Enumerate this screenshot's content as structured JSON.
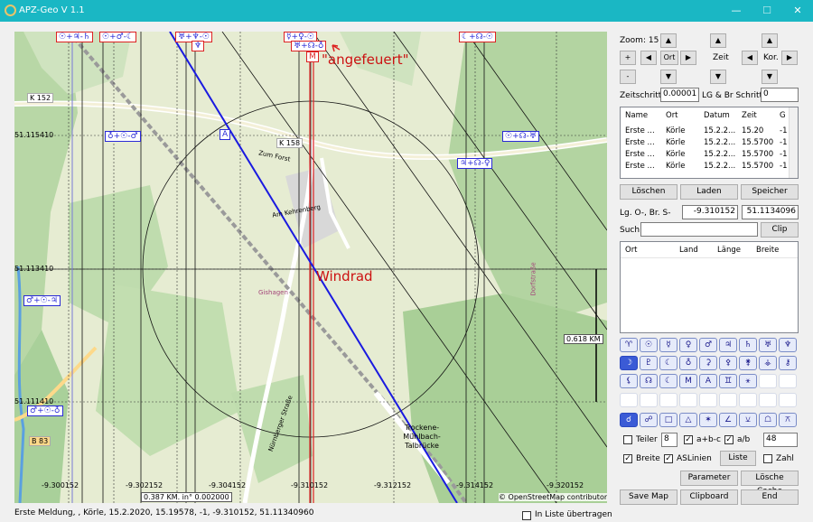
{
  "window": {
    "title": "APZ-Geo V 1.1",
    "minimize": "—",
    "maximize": "☐",
    "close": "✕"
  },
  "map": {
    "annotation_top": "\"angefeuert\"",
    "annotation_center": "Windrad",
    "attribution": "© OpenStreetMap contributors",
    "scale_text": "0.387 KM. in° 0.002000",
    "distance_label": "0.618 KM",
    "left_lat_labels": [
      "51.115410",
      "51.113410",
      "51.111410"
    ],
    "bottom_lon_labels": [
      "-9.300152",
      "-9.302152",
      "-9.304152",
      "-9.310152",
      "-9.312152",
      "-9.314152",
      "-9.320152"
    ],
    "place_labels": [
      "K 152",
      "K 158",
      "Zum Forst",
      "Am Kehrenberg",
      "Gishagen",
      "Nürnberger Straße",
      "Trockene-Mühlbach-Talbrücke",
      "B 83",
      "Dorfstraße"
    ],
    "top_boxes": [
      "☉+♃-♄",
      "☉+♂-☾",
      "♅+♆-☉",
      "♆",
      "☿+♀-☉",
      "♅+☊-♁",
      "M",
      "☾+☊-☉"
    ],
    "left_boxes": [
      "♁+☉-♂",
      "♂+☉-♃",
      "♂+☉-♁"
    ],
    "right_boxes": [
      "☉+☊-♅",
      "♃+☊-♀"
    ],
    "marker_A": "A"
  },
  "panel": {
    "zoom_label": "Zoom: 15",
    "zeit_label": "Zeit",
    "kor_label": "Kor.",
    "ort_btn": "Ort",
    "plus": "+",
    "minus": "-",
    "up": "▲",
    "down": "▼",
    "left": "◀",
    "right": "▶",
    "zeitschritt_label": "Zeitschritt",
    "zeitschritt_value": "0.00001",
    "lgbr_label": "LG & Br Schritt",
    "lgbr_value": "0",
    "table1": {
      "headers": [
        "Name",
        "Ort",
        "Datum",
        "Zeit",
        "G"
      ],
      "rows": [
        [
          "Erste ...",
          "Körle",
          "15.2.2...",
          "15.20",
          "-1"
        ],
        [
          "Erste ...",
          "Körle",
          "15.2.2...",
          "15.5700",
          "-1"
        ],
        [
          "Erste ...",
          "Körle",
          "15.2.2...",
          "15.5700",
          "-1"
        ],
        [
          "Erste ...",
          "Körle",
          "15.2.2...",
          "15.5700",
          "-1"
        ]
      ]
    },
    "loeschen": "Löschen",
    "laden": "Laden",
    "speicher": "Speicher",
    "lg_label": "Lg. O-, Br. S-",
    "lg_value": "-9.310152",
    "br_value": "51.1134096",
    "such_label": "Such",
    "such_value": "",
    "clip": "Clip",
    "table2": {
      "headers": [
        "Ort",
        "Land",
        "Länge",
        "Breite"
      ]
    },
    "symbols_row1": [
      "♈",
      "☉",
      "☿",
      "♀",
      "♂",
      "♃",
      "♄",
      "♅",
      "♆"
    ],
    "symbols_row2": [
      "☽",
      "♇",
      "☾",
      "♁",
      "⚳",
      "⚴",
      "⚵",
      "⚶",
      "⚷"
    ],
    "symbols_row3": [
      "⚸",
      "☊",
      "☾",
      "M",
      "A",
      "♊",
      "⚹"
    ],
    "symbols_row5": [
      "☌",
      "☍",
      "□",
      "△",
      "✶",
      "∠",
      "⚺",
      "☖",
      "⚻"
    ],
    "teiler_label": "Teiler",
    "teiler_value": "8",
    "abc_label": "a+b-c",
    "ab_label": "a/b",
    "ab_value": "48",
    "breite_label": "Breite",
    "aslinien_label": "ASLinien",
    "liste": "Liste",
    "zahl_label": "Zahl",
    "parameter": "Parameter",
    "loesche_cache": "Lösche Cache",
    "save_map": "Save Map",
    "clipboard": "Clipboard",
    "end": "End",
    "check": "✓"
  },
  "status": {
    "text": "Erste Meldung, , Körle, 15.2.2020, 15.19578, -1, -9.310152, 51.11340960",
    "in_liste": "In Liste übertragen"
  }
}
